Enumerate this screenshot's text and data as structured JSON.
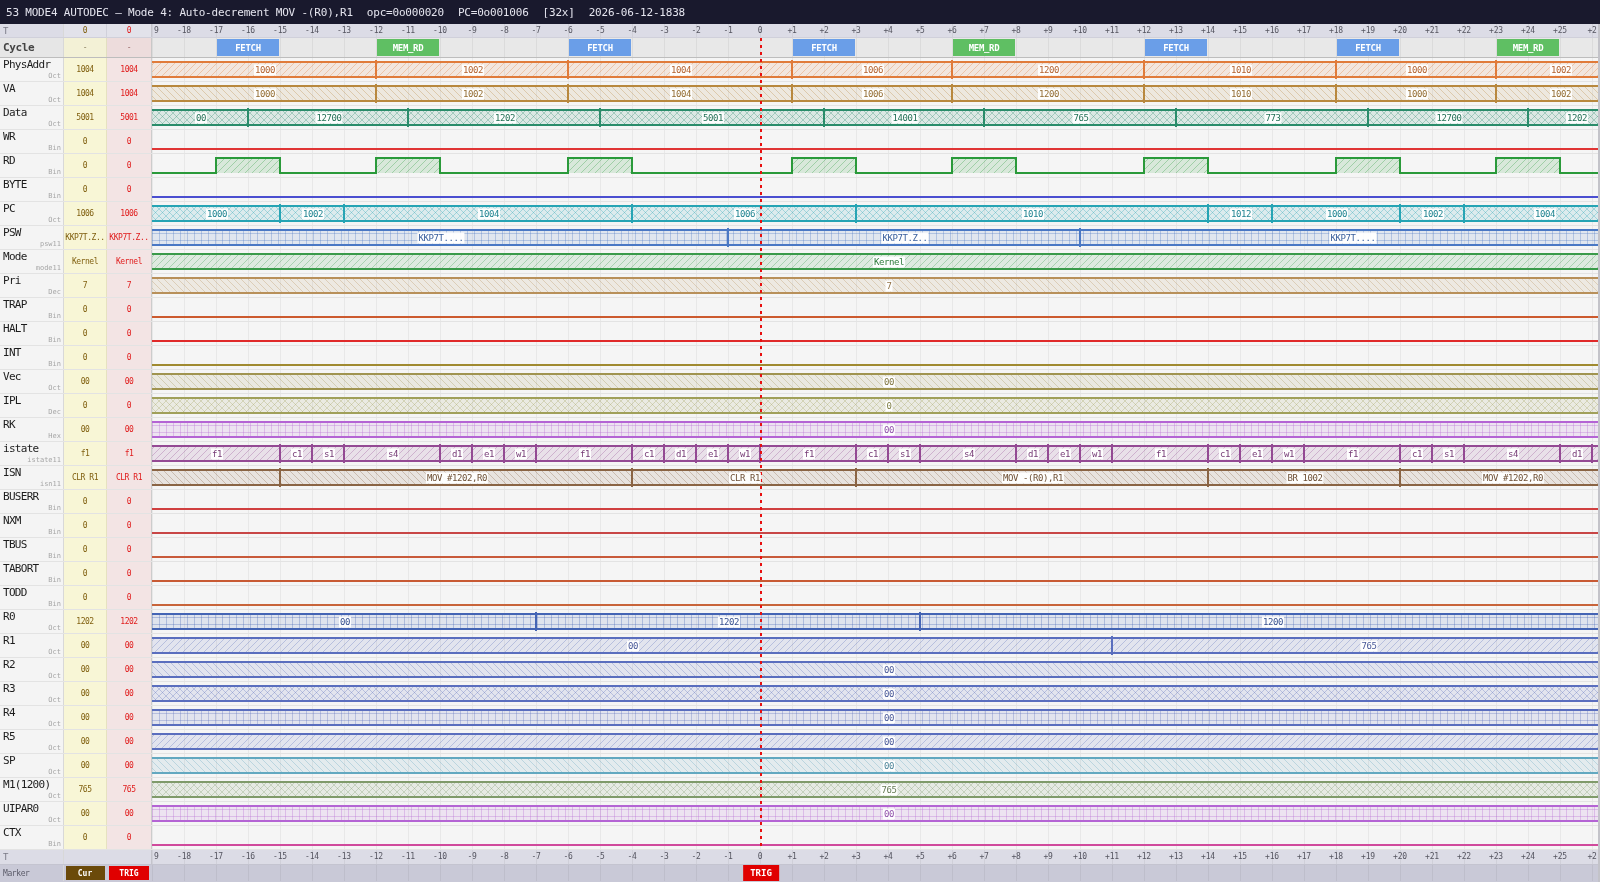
{
  "window": {
    "title": "53 MODE4 AUTODEC — Mode 4: Auto-decrement MOV -(R0),R1",
    "opcode": "opc=0o000020",
    "pc": "PC=0o001006",
    "zoom": "[32x]",
    "timestamp": "2026-06-12-1838"
  },
  "top_ruler": {
    "label": "T",
    "cursor_value": "0",
    "trigger_value": "0",
    "ticks": [
      "9",
      "-18",
      "-17",
      "-16",
      "-15",
      "-14",
      "-13",
      "-12",
      "-11",
      "-10",
      "-9",
      "-8",
      "-7",
      "-6",
      "-5",
      "-4",
      "-3",
      "-2",
      "-1",
      "0",
      "+1",
      "+2",
      "+3",
      "+4",
      "+5",
      "+6",
      "+7",
      "+8",
      "+9",
      "+10",
      "+11",
      "+12",
      "+13",
      "+14",
      "+15",
      "+16",
      "+17",
      "+18",
      "+19",
      "+20",
      "+21",
      "+22",
      "+23",
      "+24",
      "+25",
      "+2"
    ]
  },
  "cycle_row": {
    "label": "Cycle",
    "cursor_value": "-",
    "trigger_value": "-",
    "cycles": [
      {
        "label": "FETCH",
        "color": "#6a9ee8",
        "level": 0.0664
      },
      {
        "label": "MEM_RD",
        "color": "#5fbf63",
        "level": 0.177
      },
      {
        "label": "FETCH",
        "color": "#6a9ee8",
        "level": 0.3098
      },
      {
        "label": "FETCH",
        "color": "#6a9ee8",
        "level": 0.4647
      },
      {
        "label": "MEM_RD",
        "color": "#5fbf63",
        "level": 0.5754
      },
      {
        "label": "FETCH",
        "color": "#6a9ee8",
        "level": 0.7082
      },
      {
        "label": "FETCH",
        "color": "#6a9ee8",
        "level": 0.8409
      },
      {
        "label": "MEM_RD",
        "color": "#5fbf63",
        "level": 0.9516
      }
    ]
  },
  "signals": [
    {
      "name": "PhysAddr",
      "radix": "Oct",
      "cursor_value": "1004",
      "trigger_value": "1004",
      "kind": "hatch",
      "color": "#e07b3a",
      "segments": [
        {
          "value": "1000"
        },
        {
          "value": "1002",
          "level": 0.1549
        },
        {
          "value": "1004",
          "level": 0.2877
        },
        {
          "value": "1006",
          "level": 0.4426
        },
        {
          "value": "1200",
          "level": 0.5533
        },
        {
          "value": "1010",
          "level": 0.686
        },
        {
          "value": "1000",
          "level": 0.8188
        },
        {
          "value": "1002",
          "level": 0.9295
        }
      ]
    },
    {
      "name": "VA",
      "radix": "Oct",
      "cursor_value": "1004",
      "trigger_value": "1004",
      "kind": "backhatch",
      "color": "#b8883e",
      "segments": [
        {
          "value": "1000"
        },
        {
          "value": "1002",
          "level": 0.1549
        },
        {
          "value": "1004",
          "level": 0.2877
        },
        {
          "value": "1006",
          "level": 0.4426
        },
        {
          "value": "1200",
          "level": 0.5533
        },
        {
          "value": "1010",
          "level": 0.686
        },
        {
          "value": "1000",
          "level": 0.8188
        },
        {
          "value": "1002",
          "level": 0.9295
        }
      ]
    },
    {
      "name": "Data",
      "radix": "Oct",
      "cursor_value": "5001",
      "trigger_value": "5001",
      "kind": "crosshatch",
      "color": "#2a8c6a",
      "segments": [
        {
          "value": "00"
        },
        {
          "value": "12700",
          "level": 0.0664
        },
        {
          "value": "1202",
          "level": 0.177
        },
        {
          "value": "5001",
          "level": 0.3098
        },
        {
          "value": "14001",
          "level": 0.4647
        },
        {
          "value": "765",
          "level": 0.5754
        },
        {
          "value": "773",
          "level": 0.7082
        },
        {
          "value": "12700",
          "level": 0.8409
        },
        {
          "value": "1202",
          "level": 0.9516
        }
      ]
    },
    {
      "name": "WR",
      "radix": "Bin",
      "cursor_value": "0",
      "trigger_value": "0",
      "kind": "bit",
      "color": "#e03535"
    },
    {
      "name": "RD",
      "radix": "Bin",
      "cursor_value": "0",
      "trigger_value": "0",
      "kind": "bit",
      "color": "#2a9a3a",
      "edges": [
        {
          "level": 0.0443
        },
        {
          "level": 0.0885
        },
        {
          "level": 0.1549
        },
        {
          "level": 0.1992
        },
        {
          "level": 0.2877
        },
        {
          "level": 0.332
        },
        {
          "level": 0.4426
        },
        {
          "level": 0.4869
        },
        {
          "level": 0.5533
        },
        {
          "level": 0.5975
        },
        {
          "level": 0.686
        },
        {
          "level": 0.7303
        },
        {
          "level": 0.8188
        },
        {
          "level": 0.8631
        },
        {
          "level": 0.9295
        },
        {
          "level": 0.9737
        }
      ]
    },
    {
      "name": "BYTE",
      "radix": "Bin",
      "cursor_value": "0",
      "trigger_value": "0",
      "kind": "bit",
      "color": "#4a4ed0"
    },
    {
      "name": "PC",
      "radix": "Oct",
      "cursor_value": "1006",
      "trigger_value": "1006",
      "kind": "crosshatch",
      "color": "#26a4b4",
      "segments": [
        {
          "value": "1000"
        },
        {
          "value": "1002",
          "level": 0.0885
        },
        {
          "value": "1004",
          "level": 0.1328
        },
        {
          "value": "1006",
          "level": 0.332
        },
        {
          "value": "1010",
          "level": 0.4869
        },
        {
          "value": "1012",
          "level": 0.7303
        },
        {
          "value": "1000",
          "level": 0.7746
        },
        {
          "value": "1002",
          "level": 0.8631
        },
        {
          "value": "1004",
          "level": 0.9073
        }
      ]
    },
    {
      "name": "PSW",
      "radix": "psw11",
      "cursor_value": "KKP7T.Z..",
      "trigger_value": "KKP7T.Z..",
      "kind": "grid",
      "color": "#4a78c4",
      "segments": [
        {
          "value": "KKP7T...."
        },
        {
          "value": "KKP7T.Z..",
          "level": 0.3983
        },
        {
          "value": "KKP7T....",
          "level": 0.6418
        }
      ]
    },
    {
      "name": "Mode",
      "radix": "mode11",
      "cursor_value": "Kernel",
      "trigger_value": "Kernel",
      "kind": "hatch",
      "color": "#3a9a4a",
      "segments": [
        {
          "value": "Kernel"
        }
      ]
    },
    {
      "name": "Pri",
      "radix": "Dec",
      "cursor_value": "7",
      "trigger_value": "7",
      "kind": "backhatch",
      "color": "#b8905a",
      "segments": [
        {
          "value": "7"
        }
      ]
    },
    {
      "name": "TRAP",
      "radix": "Bin",
      "cursor_value": "0",
      "trigger_value": "0",
      "kind": "bit",
      "color": "#cc5a2e"
    },
    {
      "name": "HALT",
      "radix": "Bin",
      "cursor_value": "0",
      "trigger_value": "0",
      "kind": "bit",
      "color": "#e02a2a"
    },
    {
      "name": "INT",
      "radix": "Bin",
      "cursor_value": "0",
      "trigger_value": "0",
      "kind": "bit",
      "color": "#a08a30"
    },
    {
      "name": "Vec",
      "radix": "Oct",
      "cursor_value": "00",
      "trigger_value": "00",
      "kind": "backhatch",
      "color": "#a09450",
      "segments": [
        {
          "value": "00"
        }
      ]
    },
    {
      "name": "IPL",
      "radix": "Dec",
      "cursor_value": "0",
      "trigger_value": "0",
      "kind": "crosshatch",
      "color": "#a0a05a",
      "segments": [
        {
          "value": "0"
        }
      ]
    },
    {
      "name": "RK",
      "radix": "Hex",
      "cursor_value": "00",
      "trigger_value": "00",
      "kind": "grid",
      "color": "#b464d4",
      "segments": [
        {
          "value": "00"
        }
      ]
    },
    {
      "name": "istate",
      "radix": "istate11",
      "cursor_value": "f1",
      "trigger_value": "f1",
      "kind": "hatch",
      "color": "#944a94",
      "segments": [
        {
          "value": "f1"
        },
        {
          "value": "c1",
          "level": 0.0885
        },
        {
          "value": "s1",
          "level": 0.1107
        },
        {
          "value": "s4",
          "level": 0.1328
        },
        {
          "value": "d1",
          "level": 0.1992
        },
        {
          "value": "e1",
          "level": 0.2213
        },
        {
          "value": "w1",
          "level": 0.2434
        },
        {
          "value": "f1",
          "level": 0.2656
        },
        {
          "value": "c1",
          "level": 0.332
        },
        {
          "value": "d1",
          "level": 0.3541
        },
        {
          "value": "e1",
          "level": 0.3762
        },
        {
          "value": "w1",
          "level": 0.3983
        },
        {
          "value": "f1",
          "level": 0.4205
        },
        {
          "value": "c1",
          "level": 0.4869
        },
        {
          "value": "s1",
          "level": 0.509
        },
        {
          "value": "s4",
          "level": 0.5311
        },
        {
          "value": "d1",
          "level": 0.5975
        },
        {
          "value": "e1",
          "level": 0.6196
        },
        {
          "value": "w1",
          "level": 0.6418
        },
        {
          "value": "f1",
          "level": 0.6639
        },
        {
          "value": "c1",
          "level": 0.7303
        },
        {
          "value": "e1",
          "level": 0.7524
        },
        {
          "value": "w1",
          "level": 0.7746
        },
        {
          "value": "f1",
          "level": 0.7967
        },
        {
          "value": "c1",
          "level": 0.8631
        },
        {
          "value": "s1",
          "level": 0.8852
        },
        {
          "value": "s4",
          "level": 0.9073
        },
        {
          "value": "d1",
          "level": 0.9737
        },
        {
          "level": 0.9959
        }
      ]
    },
    {
      "name": "ISN",
      "radix": "isn11",
      "cursor_value": "CLR R1",
      "trigger_value": "CLR R1",
      "kind": "backhatch",
      "color": "#8a6444",
      "segments": [
        {
          "value": "MOV #1202,R0",
          "level": 0.0885
        },
        {
          "value": "CLR R1",
          "level": 0.332
        },
        {
          "value": "MOV -(R0),R1",
          "level": 0.4869
        },
        {
          "value": "BR 1002",
          "level": 0.7303
        },
        {
          "value": "MOV #1202,R0",
          "level": 0.8631
        }
      ]
    },
    {
      "name": "BUSERR",
      "radix": "Bin",
      "cursor_value": "0",
      "trigger_value": "0",
      "kind": "bit",
      "color": "#d04040"
    },
    {
      "name": "NXM",
      "radix": "Bin",
      "cursor_value": "0",
      "trigger_value": "0",
      "kind": "bit",
      "color": "#c84646"
    },
    {
      "name": "TBUS",
      "radix": "Bin",
      "cursor_value": "0",
      "trigger_value": "0",
      "kind": "bit",
      "color": "#c85a3a"
    },
    {
      "name": "TABORT",
      "radix": "Bin",
      "cursor_value": "0",
      "trigger_value": "0",
      "kind": "bit",
      "color": "#c85a34"
    },
    {
      "name": "TODD",
      "radix": "Bin",
      "cursor_value": "0",
      "trigger_value": "0",
      "kind": "bit",
      "color": "#c8643a"
    },
    {
      "name": "R0",
      "radix": "Oct",
      "cursor_value": "1202",
      "trigger_value": "1202",
      "kind": "grid",
      "color": "#4464b4",
      "segments": [
        {
          "value": "00"
        },
        {
          "value": "1202",
          "level": 0.2656
        },
        {
          "value": "1200",
          "level": 0.5311
        }
      ]
    },
    {
      "name": "R1",
      "radix": "Oct",
      "cursor_value": "00",
      "trigger_value": "00",
      "kind": "hatch",
      "color": "#5a6ebe",
      "segments": [
        {
          "value": "00"
        },
        {
          "value": "765",
          "level": 0.6639
        }
      ]
    },
    {
      "name": "R2",
      "radix": "Oct",
      "cursor_value": "00",
      "trigger_value": "00",
      "kind": "backhatch",
      "color": "#5a6ebe",
      "segments": [
        {
          "value": "00"
        }
      ]
    },
    {
      "name": "R3",
      "radix": "Oct",
      "cursor_value": "00",
      "trigger_value": "00",
      "kind": "crosshatch",
      "color": "#5a6ebe",
      "segments": [
        {
          "value": "00"
        }
      ]
    },
    {
      "name": "R4",
      "radix": "Oct",
      "cursor_value": "00",
      "trigger_value": "00",
      "kind": "grid",
      "color": "#5a6ebe",
      "segments": [
        {
          "value": "00"
        }
      ]
    },
    {
      "name": "R5",
      "radix": "Oct",
      "cursor_value": "00",
      "trigger_value": "00",
      "kind": "hatch",
      "color": "#5a6ebe",
      "segments": [
        {
          "value": "00"
        }
      ]
    },
    {
      "name": "SP",
      "radix": "Oct",
      "cursor_value": "00",
      "trigger_value": "00",
      "kind": "backhatch",
      "color": "#62a8c0",
      "segments": [
        {
          "value": "00"
        }
      ]
    },
    {
      "name": "M1(1200)",
      "radix": "Oct",
      "cursor_value": "765",
      "trigger_value": "765",
      "kind": "crosshatch",
      "color": "#7f9a6a",
      "segments": [
        {
          "value": "765"
        }
      ]
    },
    {
      "name": "UIPAR0",
      "radix": "Oct",
      "cursor_value": "00",
      "trigger_value": "00",
      "kind": "grid",
      "color": "#b464d4",
      "segments": [
        {
          "value": "00"
        }
      ]
    },
    {
      "name": "CTX",
      "radix": "Bin",
      "cursor_value": "0",
      "trigger_value": "0",
      "kind": "bit",
      "color": "#d04a9c"
    }
  ],
  "bottom_ruler": {
    "label": "T",
    "ticks": [
      "9",
      "-18",
      "-17",
      "-16",
      "-15",
      "-14",
      "-13",
      "-12",
      "-11",
      "-10",
      "-9",
      "-8",
      "-7",
      "-6",
      "-5",
      "-4",
      "-3",
      "-2",
      "-1",
      "0",
      "+1",
      "+2",
      "+3",
      "+4",
      "+5",
      "+6",
      "+7",
      "+8",
      "+9",
      "+10",
      "+11",
      "+12",
      "+13",
      "+14",
      "+15",
      "+16",
      "+17",
      "+18",
      "+19",
      "+20",
      "+21",
      "+22",
      "+23",
      "+24",
      "+25",
      "+2"
    ]
  },
  "marker_row": {
    "label": "Marker",
    "cursor_marker": "Cur",
    "trigger_marker": "TRIG",
    "trigger_flag": {
      "label": "TRIG",
      "level": 0.4205
    }
  }
}
